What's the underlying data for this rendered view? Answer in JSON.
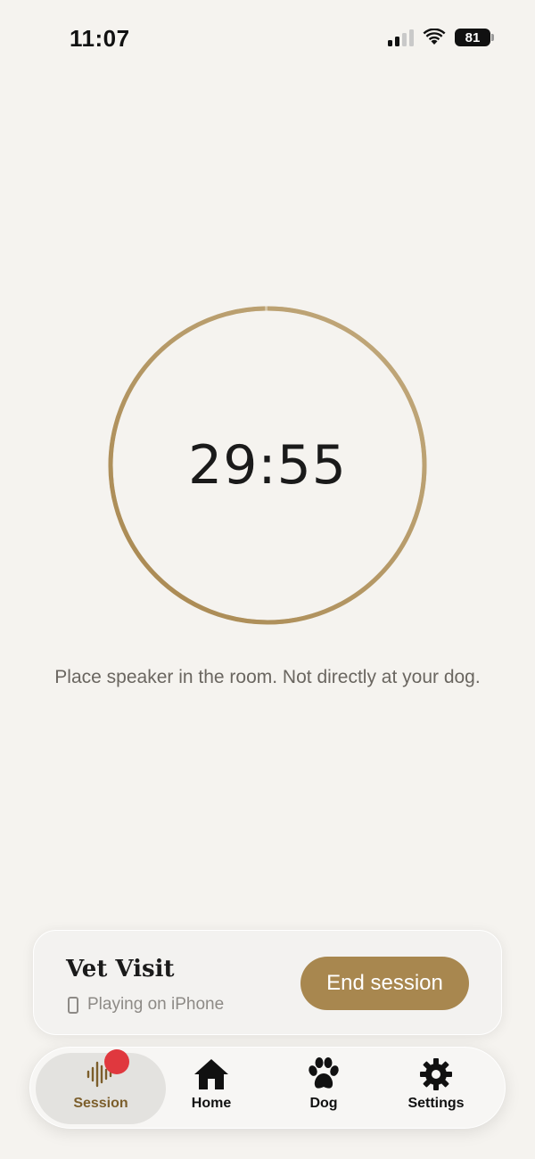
{
  "status_bar": {
    "time": "11:07",
    "battery_level": "81",
    "signal_bars_active": 2,
    "signal_bars_total": 4
  },
  "timer": {
    "remaining": "29:55",
    "progress_fraction": 0.997,
    "ring_color_start": "#a8874f",
    "ring_color_end": "#cbb794"
  },
  "instruction_text": "Place speaker in the room. Not directly at your dog.",
  "now_playing": {
    "title": "Vet Visit",
    "subtitle": "Playing on iPhone",
    "end_label": "End session"
  },
  "tabs": [
    {
      "label": "Session",
      "icon": "waveform-icon",
      "active": true
    },
    {
      "label": "Home",
      "icon": "home-icon",
      "active": false
    },
    {
      "label": "Dog",
      "icon": "paw-icon",
      "active": false
    },
    {
      "label": "Settings",
      "icon": "gear-icon",
      "active": false
    }
  ],
  "colors": {
    "accent": "#a8874f",
    "recording": "#e0383e",
    "background": "#f5f3ef"
  }
}
